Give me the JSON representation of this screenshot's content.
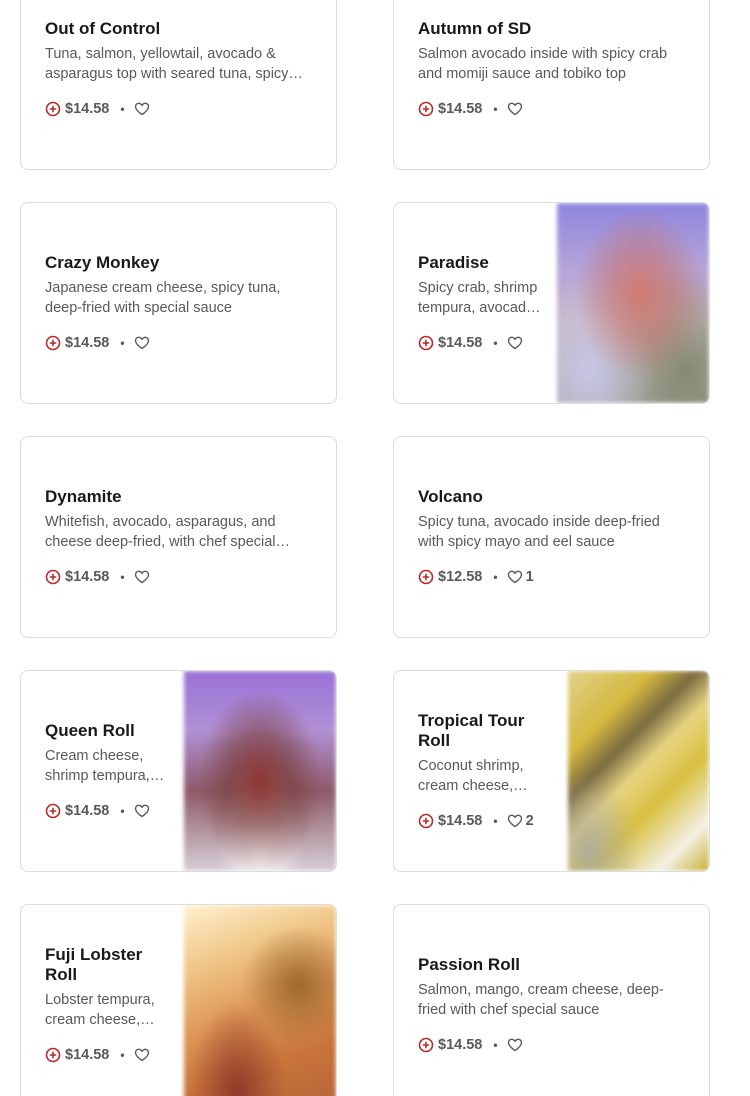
{
  "colors": {
    "accent": "#b72a2a",
    "border": "#dcdcdc",
    "text": "#191919",
    "muted": "#595959"
  },
  "separator": "•",
  "items": [
    {
      "name": "Out of Control",
      "description": "Tuna, salmon, yellowtail, avocado & asparagus top with seared tuna, spicy mayo and eel sauce",
      "price": "$14.58",
      "likes": "",
      "image": ""
    },
    {
      "name": "Autumn of SD",
      "description": "Salmon avocado inside with spicy crab and momiji sauce and tobiko top",
      "price": "$14.58",
      "likes": "",
      "image": ""
    },
    {
      "name": "Crazy Monkey",
      "description": "Japanese cream cheese, spicy tuna, deep-fried with special sauce",
      "price": "$14.58",
      "likes": "",
      "image": ""
    },
    {
      "name": "Paradise",
      "description": "Spicy crab, shrimp tempura, avocado inside",
      "price": "$14.58",
      "likes": "",
      "image": "paradise-roll-photo"
    },
    {
      "name": "Dynamite",
      "description": "Whitefish, avocado, asparagus, and cheese deep-fried, with chef special sauce",
      "price": "$14.58",
      "likes": "",
      "image": ""
    },
    {
      "name": "Volcano",
      "description": "Spicy tuna, avocado inside deep-fried with spicy mayo and eel sauce",
      "price": "$12.58",
      "likes": "1",
      "image": ""
    },
    {
      "name": "Queen Roll",
      "description": "Cream cheese, shrimp tempura, avocado inside",
      "price": "$14.58",
      "likes": "",
      "image": "queen-roll-photo"
    },
    {
      "name": "Tropical Tour Roll",
      "description": "Coconut shrimp, cream cheese, mango on top",
      "price": "$14.58",
      "likes": "2",
      "image": "tropical-tour-roll-photo"
    },
    {
      "name": "Fuji Lobster Roll",
      "description": "Lobster tempura, cream cheese, avocado inside",
      "price": "$14.58",
      "likes": "",
      "image": "fuji-lobster-roll-photo"
    },
    {
      "name": "Passion Roll",
      "description": "Salmon, mango, cream cheese, deep-fried with chef special sauce",
      "price": "$14.58",
      "likes": "",
      "image": ""
    }
  ]
}
